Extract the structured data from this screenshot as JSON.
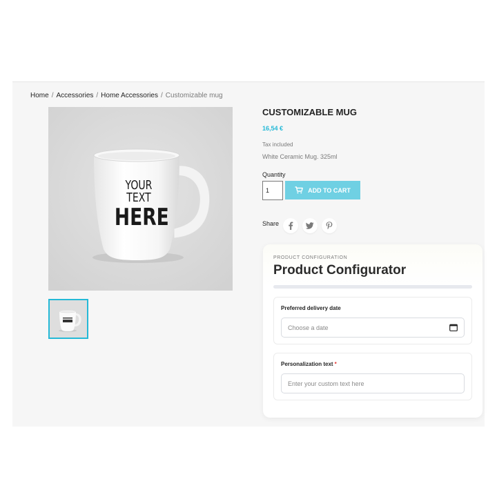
{
  "breadcrumb": {
    "items": [
      "Home",
      "Accessories",
      "Home Accessories"
    ],
    "current": "Customizable mug",
    "separator": "/"
  },
  "product": {
    "title": "CUSTOMIZABLE MUG",
    "price": "16,54 €",
    "tax_note": "Tax included",
    "description": "White Ceramic Mug. 325ml",
    "image_text_line1": "YOUR TEXT",
    "image_text_line2": "HERE"
  },
  "purchase": {
    "quantity_label": "Quantity",
    "quantity_value": "1",
    "add_to_cart_label": "ADD TO CART"
  },
  "share": {
    "label": "Share",
    "icons": [
      "facebook-icon",
      "twitter-icon",
      "pinterest-icon"
    ]
  },
  "configurator": {
    "eyebrow": "PRODUCT CONFIGURATION",
    "title": "Product Configurator",
    "fields": [
      {
        "label": "Preferred delivery date",
        "placeholder": "Choose a date",
        "icon": "calendar-icon"
      },
      {
        "label": "Personalization text",
        "required_mark": "*",
        "placeholder": "Enter your custom text here"
      }
    ]
  },
  "colors": {
    "accent": "#24b9d7",
    "button": "#6fd0e3",
    "required": "#e53935"
  }
}
